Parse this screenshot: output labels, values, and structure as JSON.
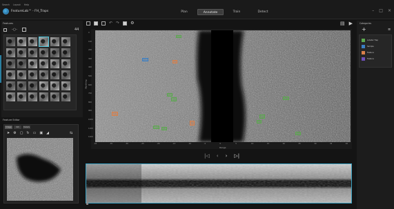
{
  "menu": [
    "Search",
    "Layout",
    "Help"
  ],
  "app": {
    "title": "FeatureLab™ - FH_Traps"
  },
  "tabs": [
    {
      "label": "Plan",
      "active": false
    },
    {
      "label": "Annotate",
      "active": true
    },
    {
      "label": "Train",
      "active": false
    },
    {
      "label": "Detect",
      "active": false
    }
  ],
  "window_controls": [
    "minimize",
    "maximize",
    "close"
  ],
  "features": {
    "title": "Features",
    "count": "44"
  },
  "feature_editor": {
    "title": "Feature Editor",
    "tabs": [
      "Image",
      "Info",
      "Details"
    ]
  },
  "plot": {
    "y_label": "Northing",
    "x_label": "Range",
    "y_ticks": [
      "0",
      "100",
      "200",
      "300",
      "400",
      "500",
      "600",
      "700",
      "800",
      "900",
      "1000",
      "1100",
      "1200"
    ],
    "x_ticks": [
      "-40",
      "-35",
      "-30",
      "-25",
      "-20",
      "-15",
      "-10",
      "-5",
      "0",
      "5",
      "10",
      "15",
      "20",
      "25",
      "30",
      "35",
      "40"
    ]
  },
  "categories": {
    "title": "Categories",
    "items": [
      {
        "label": "Lobster Trap",
        "color": "#5ba84e"
      },
      {
        "label": "Sample",
        "color": "#3b7fc4"
      },
      {
        "label": "Feature",
        "color": "#d9804a"
      },
      {
        "label": "Feature",
        "color": "#6d4fb8"
      }
    ]
  },
  "colors": {
    "accent": "#3aa3c4",
    "active_tab": "#3d3d3d"
  }
}
